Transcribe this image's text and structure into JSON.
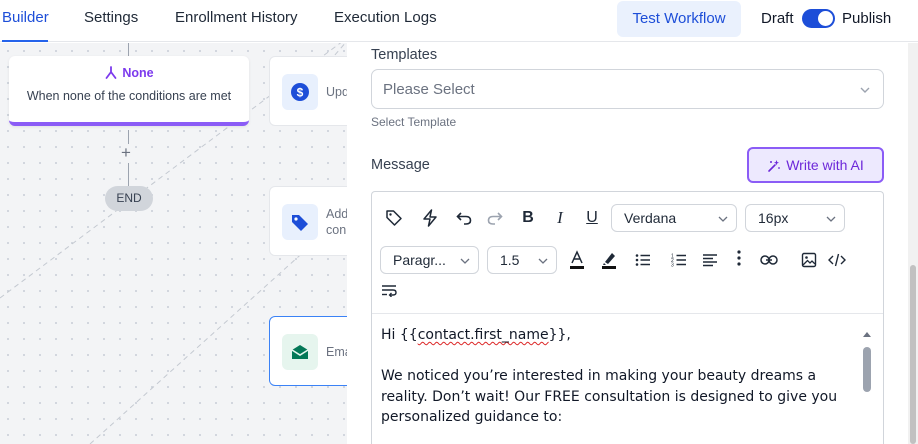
{
  "nav": {
    "tabs": [
      {
        "label": "Builder",
        "active": true
      },
      {
        "label": "Settings"
      },
      {
        "label": "Enrollment History"
      },
      {
        "label": "Execution Logs"
      }
    ],
    "test_button": "Test Workflow",
    "draft_label": "Draft",
    "publish_label": "Publish",
    "published": true
  },
  "canvas": {
    "none_card": {
      "title": "None",
      "description": "When none of the conditions are met"
    },
    "plus": "+",
    "end_label": "END",
    "nodes": [
      {
        "text": "Upd",
        "icon": "dollar-icon"
      },
      {
        "text": "Add\ncon",
        "icon": "tag-icon"
      },
      {
        "text": "Ema",
        "icon": "email-icon"
      }
    ]
  },
  "panel": {
    "templates_label": "Templates",
    "templates_placeholder": "Please Select",
    "templates_hint": "Select Template",
    "message_label": "Message",
    "ai_button": "Write with AI",
    "toolbar": {
      "font_family": "Verdana",
      "font_size": "16px",
      "block_format": "Paragr...",
      "line_height": "1.5"
    },
    "message": {
      "greeting_prefix": "Hi {{",
      "greeting_var": "contact.first_name",
      "greeting_suffix": "}},",
      "paragraph": "We noticed you’re interested in making your beauty dreams a reality. Don’t wait! Our FREE consultation is designed to give you personalized guidance to:"
    }
  },
  "colors": {
    "primary": "#1d4ed8",
    "accent_purple": "#8b5cf6",
    "email_green": "#047857"
  }
}
